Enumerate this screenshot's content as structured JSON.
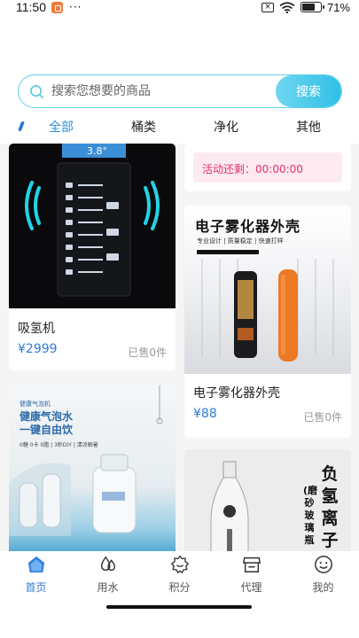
{
  "status_bar": {
    "time": "11:50",
    "dots": "···",
    "battery_text": "71%",
    "battery_level": 0.71
  },
  "search": {
    "placeholder": "搜索您想要的商品",
    "button_label": "搜索"
  },
  "tabs": [
    {
      "label": "全部",
      "active": true
    },
    {
      "label": "桶类",
      "active": false
    },
    {
      "label": "净化",
      "active": false
    },
    {
      "label": "其他",
      "active": false
    }
  ],
  "products": {
    "hydrogen_machine": {
      "title": "吸氢机",
      "price": "¥2999",
      "sold": "已售0件",
      "image_display": "3.8°"
    },
    "activity": {
      "countdown": "活动还剩：00:00:00"
    },
    "ecig_shell": {
      "title": "电子雾化器外壳",
      "price": "¥88",
      "sold": "已售0件",
      "image_title": "电子雾化器外壳",
      "image_sub": "专业设计 | 质量稳定 | 快速打样"
    },
    "bubble_water": {
      "image_brand": "健康气泡机",
      "image_title_1": "健康气泡水",
      "image_title_2": "一键自由饮",
      "image_sub": "0糖 0卡 0脂 | 3秒DIY | 清凉解暑"
    },
    "bottle": {
      "image_text_main": "负氢离子",
      "image_text_side": "(磨砂玻璃瓶"
    }
  },
  "bottom_nav": [
    {
      "label": "首页",
      "icon": "home-icon",
      "active": true
    },
    {
      "label": "用水",
      "icon": "water-drop-icon",
      "active": false
    },
    {
      "label": "积分",
      "icon": "points-badge-icon",
      "active": false
    },
    {
      "label": "代理",
      "icon": "store-icon",
      "active": false
    },
    {
      "label": "我的",
      "icon": "smiley-profile-icon",
      "active": false
    }
  ],
  "colors": {
    "accent": "#2f7ad8",
    "search_border": "#62d0ea",
    "search_button": "#2fbfe6",
    "countdown_text": "#e0306a",
    "countdown_bg": "#fdeaf0"
  }
}
